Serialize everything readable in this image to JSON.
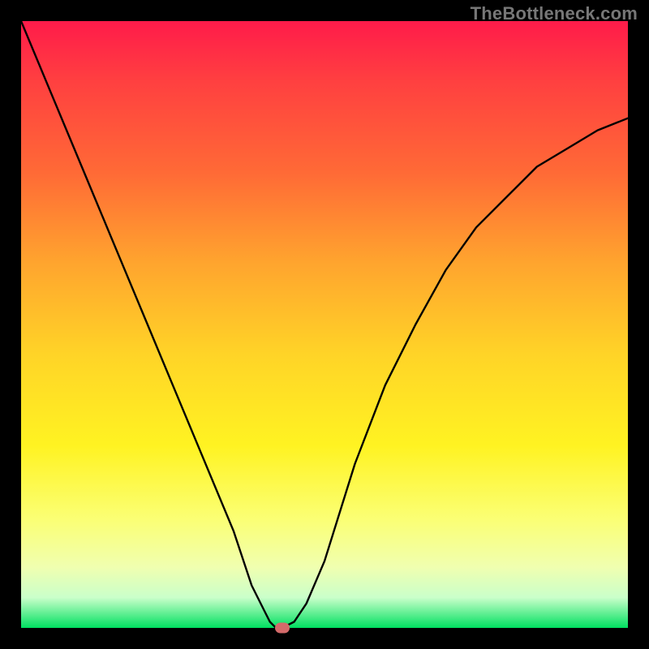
{
  "watermark": "TheBottleneck.com",
  "chart_data": {
    "type": "line",
    "title": "",
    "xlabel": "",
    "ylabel": "",
    "xlim": [
      0,
      1
    ],
    "ylim": [
      0,
      1
    ],
    "x": [
      0.0,
      0.05,
      0.1,
      0.15,
      0.2,
      0.25,
      0.3,
      0.35,
      0.38,
      0.4,
      0.41,
      0.42,
      0.43,
      0.45,
      0.47,
      0.5,
      0.55,
      0.6,
      0.65,
      0.7,
      0.75,
      0.8,
      0.85,
      0.9,
      0.95,
      1.0
    ],
    "values": [
      1.0,
      0.88,
      0.76,
      0.64,
      0.52,
      0.4,
      0.28,
      0.16,
      0.07,
      0.03,
      0.01,
      0.0,
      0.0,
      0.01,
      0.04,
      0.11,
      0.27,
      0.4,
      0.5,
      0.59,
      0.66,
      0.71,
      0.76,
      0.79,
      0.82,
      0.84
    ],
    "marker": {
      "x": 0.43,
      "y": 0.0,
      "color": "#d46a6a"
    },
    "background_gradient": [
      "#ff1b4a",
      "#ff6a36",
      "#ffd427",
      "#fff322",
      "#caffca",
      "#00e060"
    ],
    "curve_color": "#000000"
  }
}
